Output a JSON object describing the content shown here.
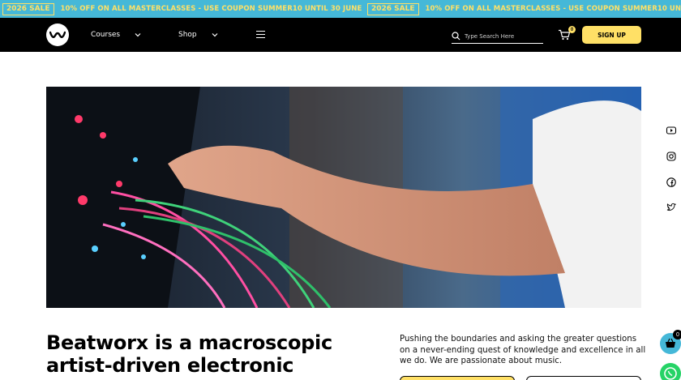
{
  "promo": {
    "badge": "2026 SALE",
    "text": "10% OFF ON ALL MASTERCLASSES - USE COUPON SUMMER10 UNTIL 30 JUNE"
  },
  "nav": {
    "logo_icon": "waveform-logo-icon",
    "courses_label": "Courses",
    "shop_label": "Shop",
    "search_placeholder": "Type Search Here",
    "cart_count": "0",
    "signup_label": "SIGN UP"
  },
  "hero": {
    "image_subject": "hand patching cables on a modular synthesizer"
  },
  "social": [
    "youtube-icon",
    "instagram-icon",
    "facebook-icon",
    "twitter-icon"
  ],
  "content": {
    "headline": "Beatworx is a macroscopic artist-driven electronic",
    "blurb": "Pushing the boundaries and asking the greater questions on a never-ending quest of knowledge and excellence in all we do. We are passionate about music."
  },
  "floating": {
    "basket_count": "0"
  },
  "colors": {
    "promo_bg": "#45b8d8",
    "accent_yellow": "#ffe066",
    "nav_bg": "#000000",
    "whatsapp_green": "#25d366"
  }
}
